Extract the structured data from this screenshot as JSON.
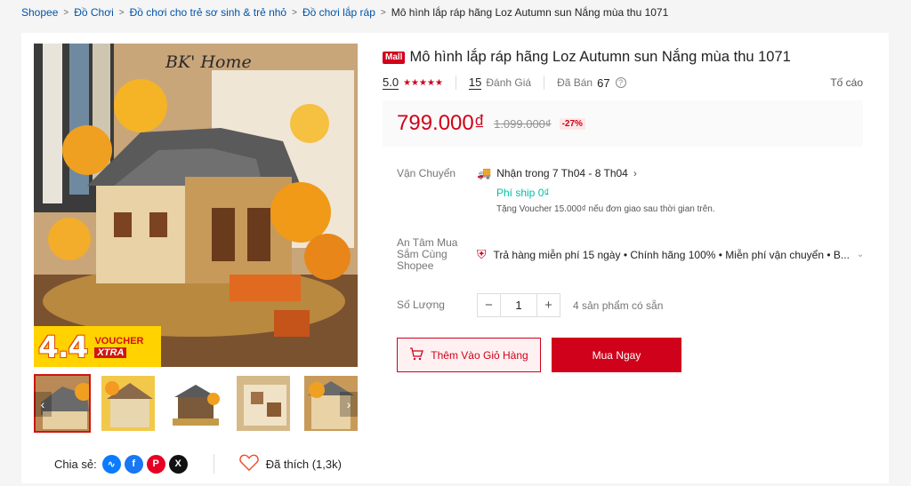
{
  "breadcrumb": {
    "items": [
      "Shopee",
      "Đồ Chơi",
      "Đồ chơi cho trẻ sơ sinh & trẻ nhỏ",
      "Đồ chơi lắp ráp"
    ],
    "current": "Mô hình lắp ráp hãng Loz Autumn sun Nắng mùa thu 1071"
  },
  "gallery": {
    "image_brand_text": "BK' Home",
    "voucher_number": "4.4",
    "voucher_line1": "VOUCHER",
    "voucher_line2": "XTRA",
    "thumbnails_count": 5
  },
  "share": {
    "label": "Chia sẻ:",
    "icons": [
      "messenger-icon",
      "facebook-icon",
      "pinterest-icon",
      "x-icon"
    ],
    "likes_label": "Đã thích (1,3k)"
  },
  "product": {
    "badge": "Mall",
    "title": "Mô hình lắp ráp hãng Loz Autumn sun Nắng mùa thu 1071",
    "rating": "5.0",
    "rating_stars": 5,
    "reviews_count": "15",
    "reviews_label": "Đánh Giá",
    "sold_label": "Đã Bán",
    "sold_count": "67",
    "report_label": "Tố cáo",
    "price": "799.000₫",
    "original_price": "1.099.000₫",
    "discount": "-27%"
  },
  "shipping": {
    "label": "Vận Chuyển",
    "delivery": "Nhận trong 7 Th04 - 8 Th04",
    "fee": "Phí ship 0₫",
    "note": "Tặng Voucher 15.000₫ nếu đơn giao sau thời gian trên."
  },
  "assurance": {
    "label": "An Tâm Mua Sắm Cùng Shopee",
    "text": "Trả hàng miễn phí 15 ngày • Chính hãng 100% • Miễn phí vận chuyển • B..."
  },
  "quantity": {
    "label": "Số Lượng",
    "value": "1",
    "stock": "4 sản phẩm có sẵn"
  },
  "actions": {
    "add_to_cart": "Thêm Vào Giỏ Hàng",
    "buy_now": "Mua Ngay"
  },
  "colors": {
    "brand_red": "#d0011b",
    "link_blue": "#0055aa",
    "ship_green": "#00bfa5"
  }
}
